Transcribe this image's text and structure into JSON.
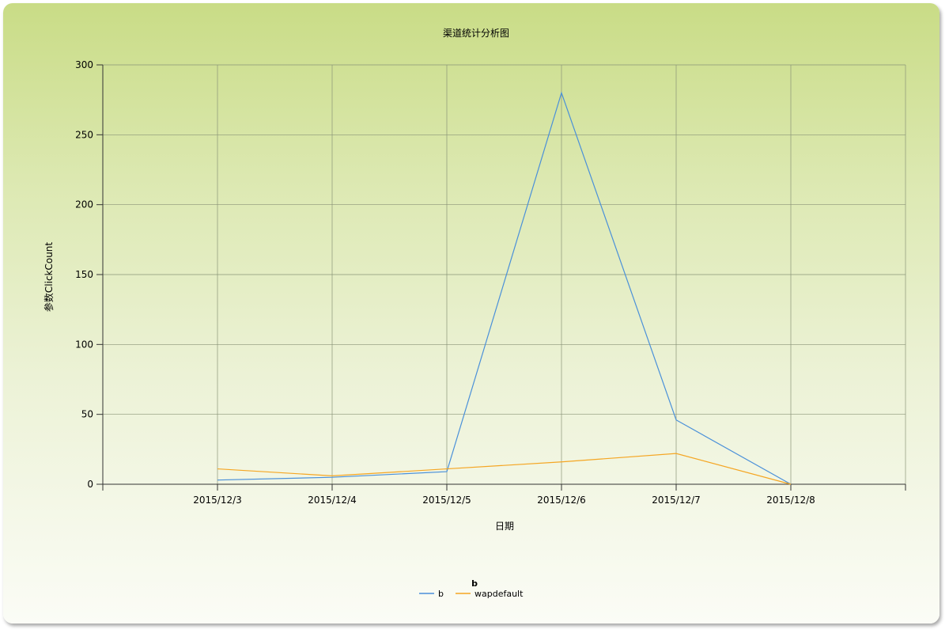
{
  "chart_data": {
    "type": "line",
    "title": "渠道统计分析图",
    "xlabel": "日期",
    "ylabel": "参数ClickCount",
    "categories": [
      "2015/12/3",
      "2015/12/4",
      "2015/12/5",
      "2015/12/6",
      "2015/12/7",
      "2015/12/8"
    ],
    "series": [
      {
        "name": "b",
        "color": "#4a90d9",
        "values": [
          3,
          5,
          9,
          280,
          46,
          0
        ]
      },
      {
        "name": "wapdefault",
        "color": "#f5a623",
        "values": [
          11,
          6,
          11,
          16,
          22,
          0
        ]
      }
    ],
    "ylim": [
      0,
      300
    ],
    "yticks": [
      0,
      50,
      100,
      150,
      200,
      250,
      300
    ],
    "grid": true,
    "legend": {
      "title": "b",
      "position": "bottom-center"
    }
  }
}
